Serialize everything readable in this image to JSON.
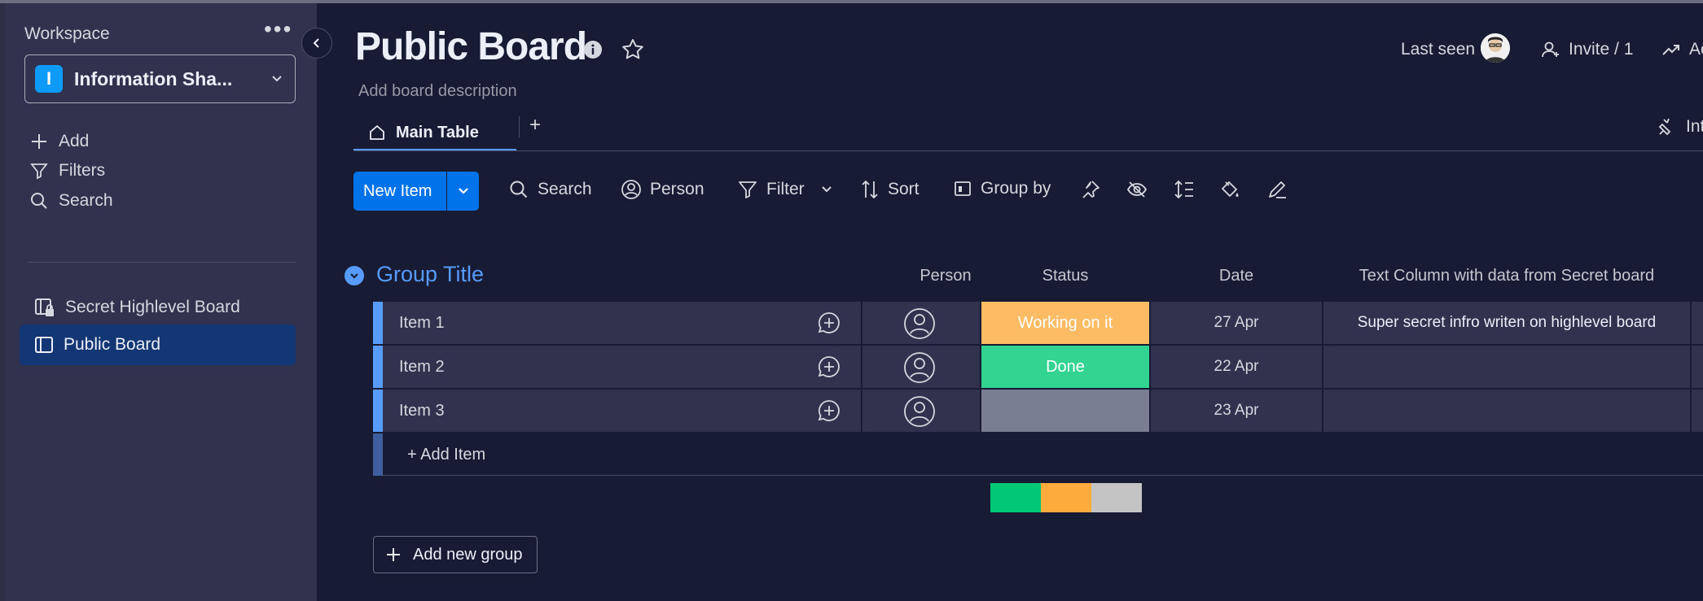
{
  "sidebar": {
    "workspace_label": "Workspace",
    "more_glyph": "•••",
    "workspace_letter": "I",
    "workspace_name": "Information Sha...",
    "nav": [
      {
        "label": "Add",
        "icon": "plus-icon"
      },
      {
        "label": "Filters",
        "icon": "filter-icon"
      },
      {
        "label": "Search",
        "icon": "search-icon"
      }
    ],
    "boards": [
      {
        "label": "Secret Highlevel Board",
        "icon": "locked-board-icon",
        "active": false
      },
      {
        "label": "Public Board",
        "icon": "board-icon",
        "active": true
      }
    ]
  },
  "header": {
    "title": "Public Board",
    "description": "Add board description",
    "last_seen": "Last seen",
    "invite": "Invite / 1",
    "activity": "Ac"
  },
  "tabs": {
    "main": "Main Table",
    "add": "+",
    "integrate": "Int"
  },
  "toolbar": {
    "new_item": "New Item",
    "search": "Search",
    "person": "Person",
    "filter": "Filter",
    "sort": "Sort",
    "group_by": "Group by"
  },
  "group": {
    "title": "Group Title",
    "color": "#579bfc",
    "columns": {
      "person": "Person",
      "status": "Status",
      "date": "Date",
      "text": "Text Column with data from Secret board"
    },
    "rows": [
      {
        "name": "Item 1",
        "status": "Working on it",
        "status_color": "#fdbc64",
        "date": "27 Apr",
        "text": "Super secret infro writen on highlevel board"
      },
      {
        "name": "Item 2",
        "status": "Done",
        "status_color": "#33d391",
        "date": "22 Apr",
        "text": ""
      },
      {
        "name": "Item 3",
        "status": "",
        "status_color": "#797e93",
        "date": "23 Apr",
        "text": ""
      }
    ],
    "add_item": "+ Add Item",
    "status_summary": [
      {
        "color": "#00c875",
        "fraction": 0.3333
      },
      {
        "color": "#fdab3d",
        "fraction": 0.3333
      },
      {
        "color": "#c4c4c4",
        "fraction": 0.3334
      }
    ]
  },
  "add_group": "Add new group"
}
